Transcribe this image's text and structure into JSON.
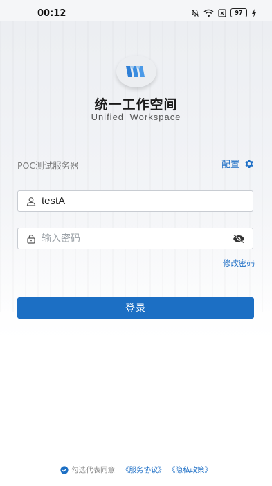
{
  "status_bar": {
    "time": "00:12",
    "battery": "97",
    "icons": [
      "bell-off-icon",
      "wifi-icon",
      "sim-icon",
      "battery-icon",
      "charging-icon"
    ]
  },
  "app": {
    "title": "统一工作空间",
    "subtitle": "Unified Workspace",
    "logo": "app-logo"
  },
  "server": {
    "name": "POC测试服务器",
    "config_label": "配置"
  },
  "form": {
    "username_value": "testA",
    "password_placeholder": "输入密码",
    "change_password": "修改密码",
    "login_label": "登录"
  },
  "agreement": {
    "text": "勾选代表同意",
    "service_link": "《服务协议》",
    "privacy_link": "《隐私政策》"
  },
  "colors": {
    "accent": "#1c6fc4",
    "link": "#1e6fc6"
  }
}
